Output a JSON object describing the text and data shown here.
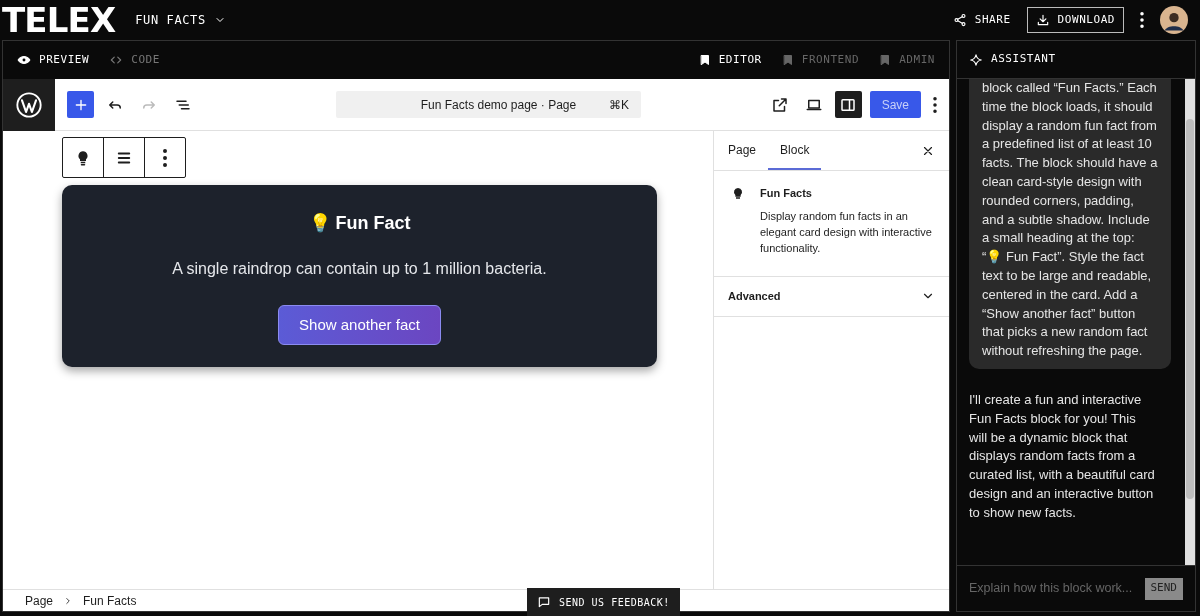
{
  "app": {
    "logo": "TELEX",
    "project": "FUN FACTS",
    "actions": [
      {
        "kind": "share",
        "label": "SHARE"
      },
      {
        "kind": "download",
        "label": "DOWNLOAD"
      }
    ]
  },
  "view_tabs": [
    {
      "label": "PREVIEW",
      "kind": "preview",
      "selected": true
    },
    {
      "label": "CODE",
      "kind": "code",
      "selected": false
    }
  ],
  "mode_tabs": [
    {
      "label": "EDITOR",
      "selected": true
    },
    {
      "label": "FRONTEND",
      "selected": false
    },
    {
      "label": "ADMIN",
      "selected": false
    }
  ],
  "editor": {
    "document_title": "Fun Facts demo page · Page",
    "shortcut": "⌘K",
    "save": "Save",
    "redo_disabled": true,
    "settings_open": true
  },
  "card": {
    "heading": "💡 Fun Fact",
    "fact": "A single raindrop can contain up to 1 million bacteria.",
    "button": "Show another fact"
  },
  "sidebar": {
    "tabs": [
      {
        "label": "Page",
        "selected": false
      },
      {
        "label": "Block",
        "selected": true
      }
    ],
    "block_name": "Fun Facts",
    "block_description": "Display random fun facts in an elegant card design with interactive functionality.",
    "sections": [
      {
        "label": "Advanced",
        "expanded": false
      }
    ]
  },
  "breadcrumb": [
    "Page",
    "Fun Facts"
  ],
  "feedback": "SEND US FEEDBACK!",
  "assistant": {
    "title": "ASSISTANT",
    "messages": [
      {
        "kind": "request",
        "text": "block called “Fun Facts.” Each time the block loads, it should display a random fun fact from a predefined list of at least 10 facts. The block should have a clean card-style design with rounded corners, padding, and a subtle shadow. Include a small heading at the top: “💡 Fun Fact”. Style the fact text to be large and readable, centered in the card. Add a “Show another fact” button that picks a new random fact without refreshing the page."
      },
      {
        "kind": "reply",
        "text": "I'll create a fun and interactive Fun Facts block for you! This will be a dynamic block that displays random facts from a curated list, with a beautiful card design and an interactive button to show new facts."
      }
    ],
    "placeholder": "Explain how this block work...",
    "send": "SEND"
  }
}
